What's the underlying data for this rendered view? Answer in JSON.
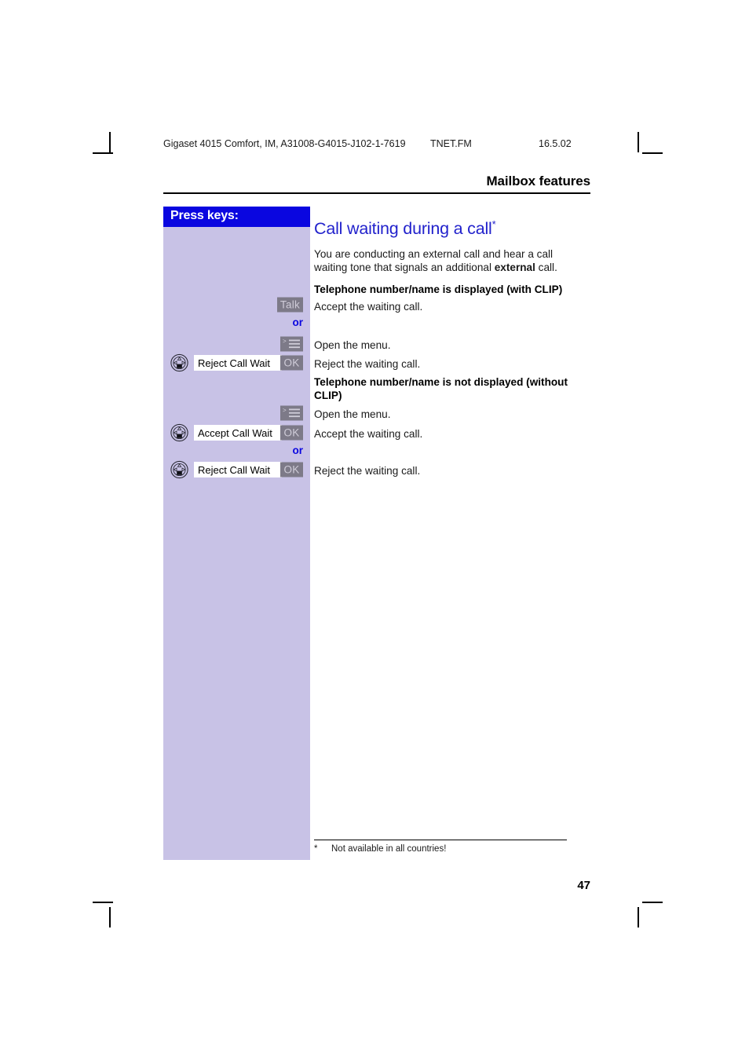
{
  "running_head": {
    "doc_id": "Gigaset 4015 Comfort, IM, A31008-G4015-J102-1-7619",
    "fm_name": "TNET.FM",
    "date": "16.5.02"
  },
  "chapter": {
    "title": "Mailbox features"
  },
  "sidebar": {
    "header_label": "Press keys:",
    "or_label": "or",
    "rows": [
      {
        "type": "softkey-talk",
        "softkey_label": "Talk",
        "icon": "talk-key-icon"
      },
      {
        "type": "or"
      },
      {
        "type": "menu-key",
        "icon": "menu-display-key-icon"
      },
      {
        "type": "nav-option",
        "icon": "navigation-key-icon",
        "option_text": "Reject Call Wait",
        "softkey_label": "OK"
      },
      {
        "type": "menu-key",
        "icon": "menu-display-key-icon"
      },
      {
        "type": "nav-option",
        "icon": "navigation-key-icon",
        "option_text": "Accept Call Wait",
        "softkey_label": "OK"
      },
      {
        "type": "or"
      },
      {
        "type": "nav-option",
        "icon": "navigation-key-icon",
        "option_text": "Reject Call Wait",
        "softkey_label": "OK"
      }
    ]
  },
  "content": {
    "title": "Call waiting during a call",
    "title_footnote_mark": "*",
    "intro_part1": "You are conducting an external call and hear a call waiting tone that signals an additional ",
    "intro_bold": "external",
    "intro_part2": " call.",
    "section_1_heading": "Telephone number/name is displayed (with CLIP)",
    "line_accept_1": "Accept the waiting call.",
    "line_open_menu_1": "Open the menu.",
    "line_reject_1": "Reject the waiting call.",
    "section_2_heading": "Telephone number/name is not displayed (without CLIP)",
    "line_open_menu_2": "Open the menu.",
    "line_accept_2": "Accept the waiting call.",
    "line_reject_2": "Reject the waiting call."
  },
  "footnote": {
    "mark": "*",
    "text": "Not available in all countries!"
  },
  "page_number": "47",
  "colors": {
    "sidebar_bg": "#c8c2e6",
    "sidebar_header_bg": "#0a06e0",
    "title_blue": "#2222cc",
    "softkey_bg": "#7d7a88",
    "softkey_text": "#cfccd8"
  }
}
